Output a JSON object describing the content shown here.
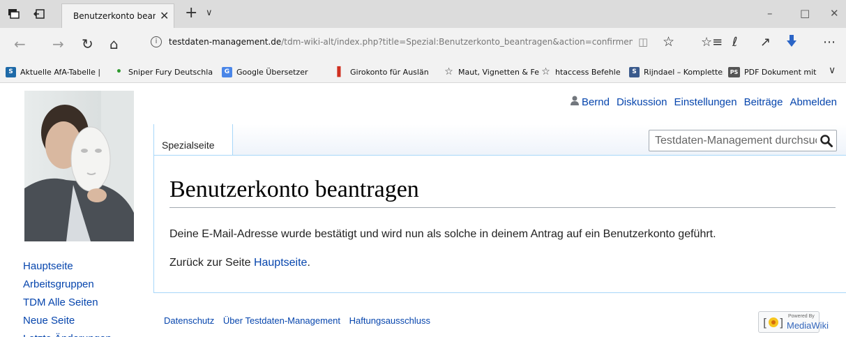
{
  "browser": {
    "tab": {
      "title": "Benutzerkonto beantrag",
      "close": "✕"
    },
    "new_tab": "+",
    "tabs_menu": "∨",
    "window": {
      "minimize": "–",
      "maximize": "□",
      "close": "✕"
    },
    "nav": {
      "back": "←",
      "forward": "→",
      "refresh": "↻",
      "home": "⌂"
    },
    "url": {
      "host": "testdaten-management.de",
      "path": "/tdm-wiki-alt/index.php?title=Spezial:Benutzerkonto_beantragen&action=confirmemail&"
    },
    "favorites": [
      {
        "label": "Aktuelle AfA-Tabelle |",
        "icon": "S",
        "color": "#1e6aa8"
      },
      {
        "label": "Sniper Fury Deutschla",
        "icon": "•",
        "color": "#2f9a2f"
      },
      {
        "label": "Google Übersetzer",
        "icon": "G",
        "color": "#4a86e8"
      },
      {
        "label": "Girokonto für Auslän",
        "icon": "▌",
        "color": "#d03020"
      },
      {
        "label": "Maut, Vignetten & Fe",
        "icon": "☆",
        "color": ""
      },
      {
        "label": "htaccess Befehle",
        "icon": "☆",
        "color": ""
      },
      {
        "label": "Rijndael – Komplettes",
        "icon": "S",
        "color": "#3a5a8c"
      },
      {
        "label": "PDF Dokument mit PI",
        "icon": "PS",
        "color": "#555555"
      }
    ],
    "favorites_more": "∨"
  },
  "wiki": {
    "personal": {
      "user": "Bernd",
      "talk": "Diskussion",
      "preferences": "Einstellungen",
      "contributions": "Beiträge",
      "logout": "Abmelden"
    },
    "page_tab": "Spezialseite",
    "search_placeholder": "Testdaten-Management durchsuchen",
    "heading": "Benutzerkonto beantragen",
    "message": "Deine E-Mail-Adresse wurde bestätigt und wird nun als solche in deinem Antrag auf ein Benutzerkonto geführt.",
    "back_prefix": "Zurück zur Seite ",
    "back_link": "Hauptseite",
    "back_suffix": ".",
    "sidebar": [
      "Hauptseite",
      "Arbeitsgruppen",
      "TDM Alle Seiten",
      "Neue Seite",
      "Letzte Änderungen"
    ],
    "footer": [
      "Datenschutz",
      "Über Testdaten-Management",
      "Haftungsausschluss"
    ],
    "powered_small": "Powered By",
    "powered_big": "MediaWiki"
  },
  "colors": {
    "link": "#0645ad",
    "border": "#a7d7f9",
    "chrome": "#f2f2f2"
  }
}
